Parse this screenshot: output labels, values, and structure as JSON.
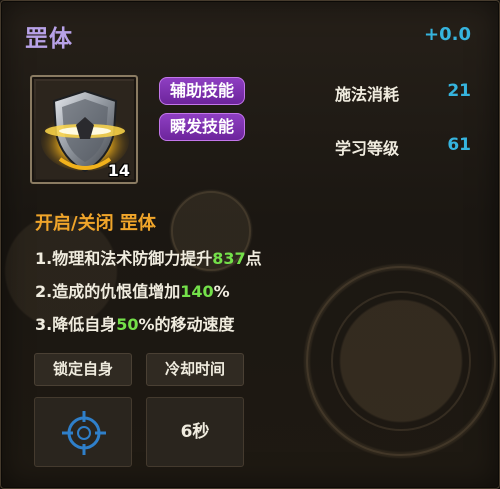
{
  "skill": {
    "name": "罡体",
    "delta": "+0.0",
    "icon": "shield-icon",
    "stack_count": "14",
    "tags": [
      "辅助技能",
      "瞬发技能"
    ]
  },
  "stats": [
    {
      "label": "施法消耗",
      "value": "21"
    },
    {
      "label": "学习等级",
      "value": "61"
    }
  ],
  "description": {
    "heading": "开启/关闭 罡体",
    "lines": [
      {
        "prefix": "1.物理和法术防御力提升",
        "highlight": "837",
        "suffix": "点"
      },
      {
        "prefix": "2.造成的仇恨值增加",
        "highlight": "140",
        "suffix": "%"
      },
      {
        "prefix": "3.降低自身",
        "highlight": "50",
        "suffix": "%的移动速度"
      }
    ]
  },
  "target": {
    "label": "锁定自身",
    "icon": "crosshair-icon"
  },
  "cooldown": {
    "label": "冷却时间",
    "value": "6秒"
  },
  "colors": {
    "title": "#b8a2e8",
    "blue_value": "#36b4de",
    "heading": "#f0a52a",
    "highlight": "#74e04a",
    "tag": "#7f33b0"
  }
}
